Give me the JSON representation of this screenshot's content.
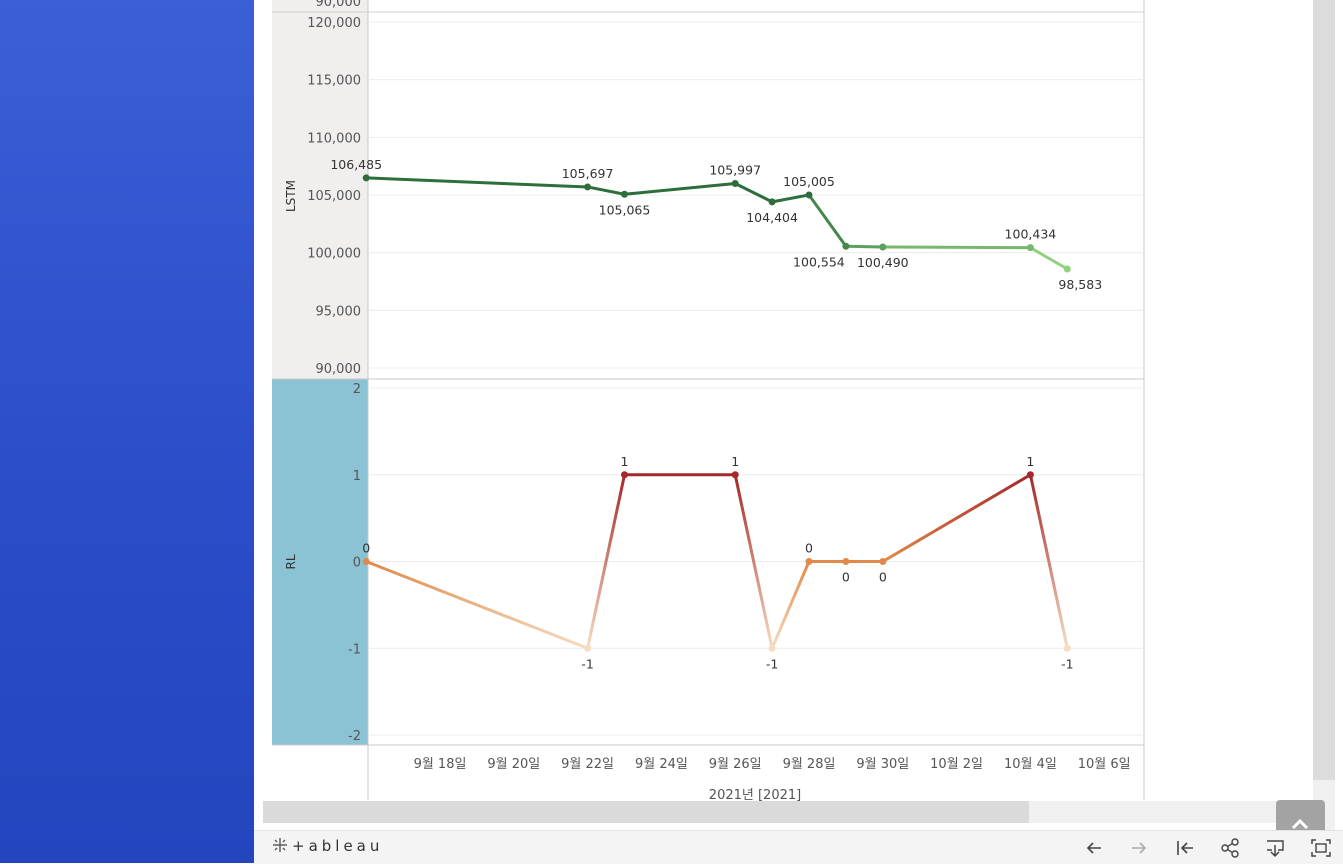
{
  "toolbar": {
    "logo_text": "+ableau",
    "icons": [
      "tableau-logo-icon",
      "undo-icon",
      "redo-icon",
      "revert-icon",
      "share-icon",
      "download-icon",
      "fullscreen-icon"
    ]
  },
  "back_to_top": {
    "icon": "chevron-up-icon"
  },
  "colors": {
    "lstm_dark": "#2d6e3c",
    "lstm_light": "#8fd17e",
    "rl_pos": "#a5282a",
    "rl_zero": "#e08a4a",
    "rl_neg": "#f5dcc2",
    "rl_header_bg": "#8bc3d4",
    "lstm_header_bg": "#f1eeee"
  },
  "chart_data": [
    {
      "type": "line",
      "ylabel": "LSTM",
      "ylim": [
        90000,
        120000
      ],
      "yticks": [
        "120,000",
        "115,000",
        "110,000",
        "105,000",
        "100,000",
        "95,000",
        "90,000"
      ],
      "grid": true,
      "x": [
        "2021-09-16",
        "2021-09-22",
        "2021-09-23",
        "2021-09-26",
        "2021-09-27",
        "2021-09-28",
        "2021-09-29",
        "2021-09-30",
        "2021-10-04",
        "2021-10-05"
      ],
      "values": [
        106485,
        105697,
        105065,
        105997,
        104404,
        105005,
        100554,
        100490,
        100434,
        98583
      ],
      "labels": [
        "106,485",
        "105,697",
        "105,065",
        "105,997",
        "104,404",
        "105,005",
        "100,554",
        "100,490",
        "100,434",
        "98,583"
      ]
    },
    {
      "type": "line",
      "ylabel": "RL",
      "ylim": [
        -2,
        2
      ],
      "yticks": [
        "2",
        "1",
        "0",
        "-1",
        "-2"
      ],
      "grid": true,
      "x": [
        "2021-09-16",
        "2021-09-22",
        "2021-09-23",
        "2021-09-26",
        "2021-09-27",
        "2021-09-28",
        "2021-09-29",
        "2021-09-30",
        "2021-10-04",
        "2021-10-05"
      ],
      "values": [
        0,
        -1,
        1,
        1,
        -1,
        0,
        0,
        0,
        1,
        -1
      ],
      "labels": [
        "0",
        "-1",
        "1",
        "1",
        "-1",
        "0",
        "0",
        "0",
        "1",
        "-1"
      ]
    }
  ],
  "xaxis": {
    "ticks": [
      "9월 18일",
      "9월 20일",
      "9월 22일",
      "9월 24일",
      "9월 26일",
      "9월 28일",
      "9월 30일",
      "10월 2일",
      "10월 4일",
      "10월 6일"
    ],
    "title": "2021년 [2021]",
    "top_cut_label": "90,000"
  }
}
